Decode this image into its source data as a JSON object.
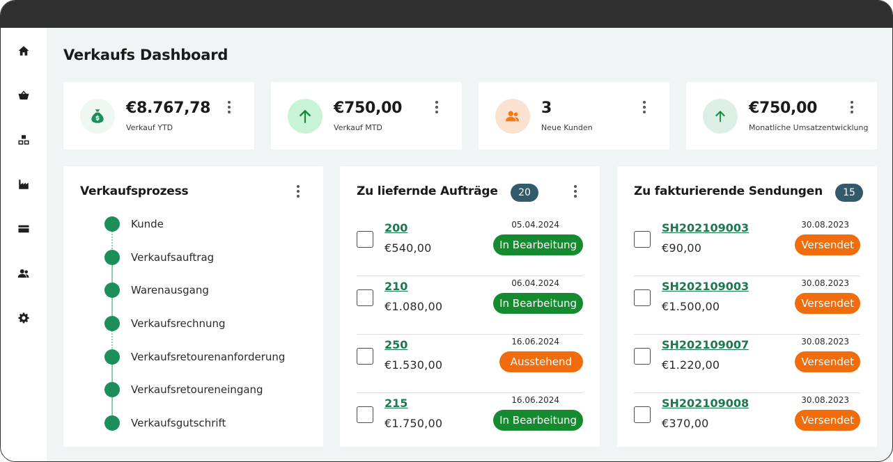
{
  "page": {
    "title": "Verkaufs Dashboard"
  },
  "sidebar": {
    "items": [
      {
        "icon": "home-icon"
      },
      {
        "icon": "basket-icon"
      },
      {
        "icon": "boxes-icon"
      },
      {
        "icon": "factory-icon"
      },
      {
        "icon": "card-icon"
      },
      {
        "icon": "people-icon"
      },
      {
        "icon": "gear-icon"
      }
    ]
  },
  "kpis": [
    {
      "value": "€8.767,78",
      "label": "Verkauf YTD",
      "icon": "money-bag-icon",
      "bg": "#eef7f1",
      "fg": "#1b8e5a"
    },
    {
      "value": "€750,00",
      "label": "Verkauf MTD",
      "icon": "arrow-up-icon",
      "bg": "#c9f3d6",
      "fg": "#178a37"
    },
    {
      "value": "3",
      "label": "Neue Kunden",
      "icon": "people-icon",
      "bg": "#fbe1cf",
      "fg": "#ee7a22"
    },
    {
      "value": "€750,00",
      "label": "Monatliche Umsatzentwicklung",
      "icon": "arrow-up-icon",
      "bg": "#dcefe5",
      "fg": "#178a37"
    }
  ],
  "process": {
    "title": "Verkaufsprozess",
    "steps": [
      "Kunde",
      "Verkaufsauftrag",
      "Warenausgang",
      "Verkaufsrechnung",
      "Verkaufsretourenanforderung",
      "Verkaufsretoureneingang",
      "Verkaufsgutschrift"
    ]
  },
  "orders": {
    "title": "Zu liefernde Aufträge",
    "count": "20",
    "rows": [
      {
        "id": "200",
        "amount": "€540,00",
        "date": "05.04.2024",
        "status": "In Bearbeitung",
        "status_color": "green"
      },
      {
        "id": "210",
        "amount": "€1.080,00",
        "date": "06.04.2024",
        "status": "In Bearbeitung",
        "status_color": "green"
      },
      {
        "id": "250",
        "amount": "€1.530,00",
        "date": "16.06.2024",
        "status": "Ausstehend",
        "status_color": "orange"
      },
      {
        "id": "215",
        "amount": "€1.750,00",
        "date": "16.06.2024",
        "status": "In Bearbeitung",
        "status_color": "green"
      }
    ]
  },
  "shipments": {
    "title": "Zu fakturierende Sendungen",
    "count": "15",
    "rows": [
      {
        "id": "SH202109003",
        "amount": "€90,00",
        "date": "30.08.2023",
        "status": "Versendet",
        "status_color": "orange"
      },
      {
        "id": "SH202109003",
        "amount": "€1.500,00",
        "date": "30.08.2023",
        "status": "Versendet",
        "status_color": "orange"
      },
      {
        "id": "SH202109007",
        "amount": "€1.220,00",
        "date": "30.08.2023",
        "status": "Versendet",
        "status_color": "orange"
      },
      {
        "id": "SH202109008",
        "amount": "€370,00",
        "date": "30.08.2023",
        "status": "Versendet",
        "status_color": "orange"
      }
    ]
  }
}
